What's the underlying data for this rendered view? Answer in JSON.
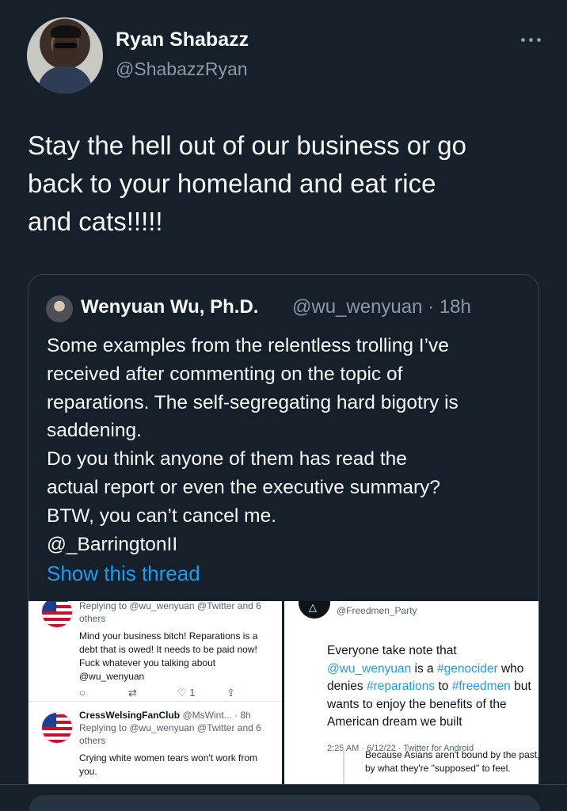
{
  "author": {
    "name": "Ryan Shabazz",
    "handle": "@ShabazzRyan"
  },
  "tweet_text_lines": [
    "Stay the hell out of our business or go",
    "back to your homeland and eat rice",
    "and cats!!!!!"
  ],
  "quoted": {
    "name": "Wenyuan Wu, Ph.D.",
    "handle_time": "@wu_wenyuan · 18h",
    "lines": [
      "Some examples from the relentless trolling I’ve",
      "received after commenting on the topic of",
      "reparations. The self-segregating hard bigotry is",
      "saddening.",
      "Do you think anyone of them has read the",
      "actual report or even the executive summary?",
      "BTW, you can’t cancel me.",
      "@_BarringtonII"
    ],
    "show_thread": "Show this thread"
  },
  "collage": {
    "left1": {
      "replying": "Replying to @wu_wenyuan @Twitter and 6",
      "replying2": "others",
      "lines": [
        "Mind your business bitch! Reparations is a",
        "debt that is owed! It needs to be paid now!",
        "Fuck whatever you talking about",
        "@wu_wenyuan"
      ],
      "like_count": "1"
    },
    "left2": {
      "name": "CressWelsingFanClub",
      "meta": "@MsWint... · 8h",
      "replying": "Replying to @wu_wenyuan @Twitter and 6",
      "replying2": "others",
      "lines": [
        "Crying white women tears won't work from",
        "you."
      ]
    },
    "right": {
      "handle": "@Freedmen_Party",
      "lines": [
        "Everyone take note that",
        "@wu_wenyuan is a #genocider who",
        "denies #reparations to #freedmen but",
        "wants to enjoy the benefits of the",
        "American dream we built"
      ],
      "meta": "2:25 AM · 6/12/22 · Twitter for Android",
      "bottom_lines": [
        "Because Asians aren't bound by the past,",
        "by what they're \"supposed\" to feel."
      ]
    }
  }
}
